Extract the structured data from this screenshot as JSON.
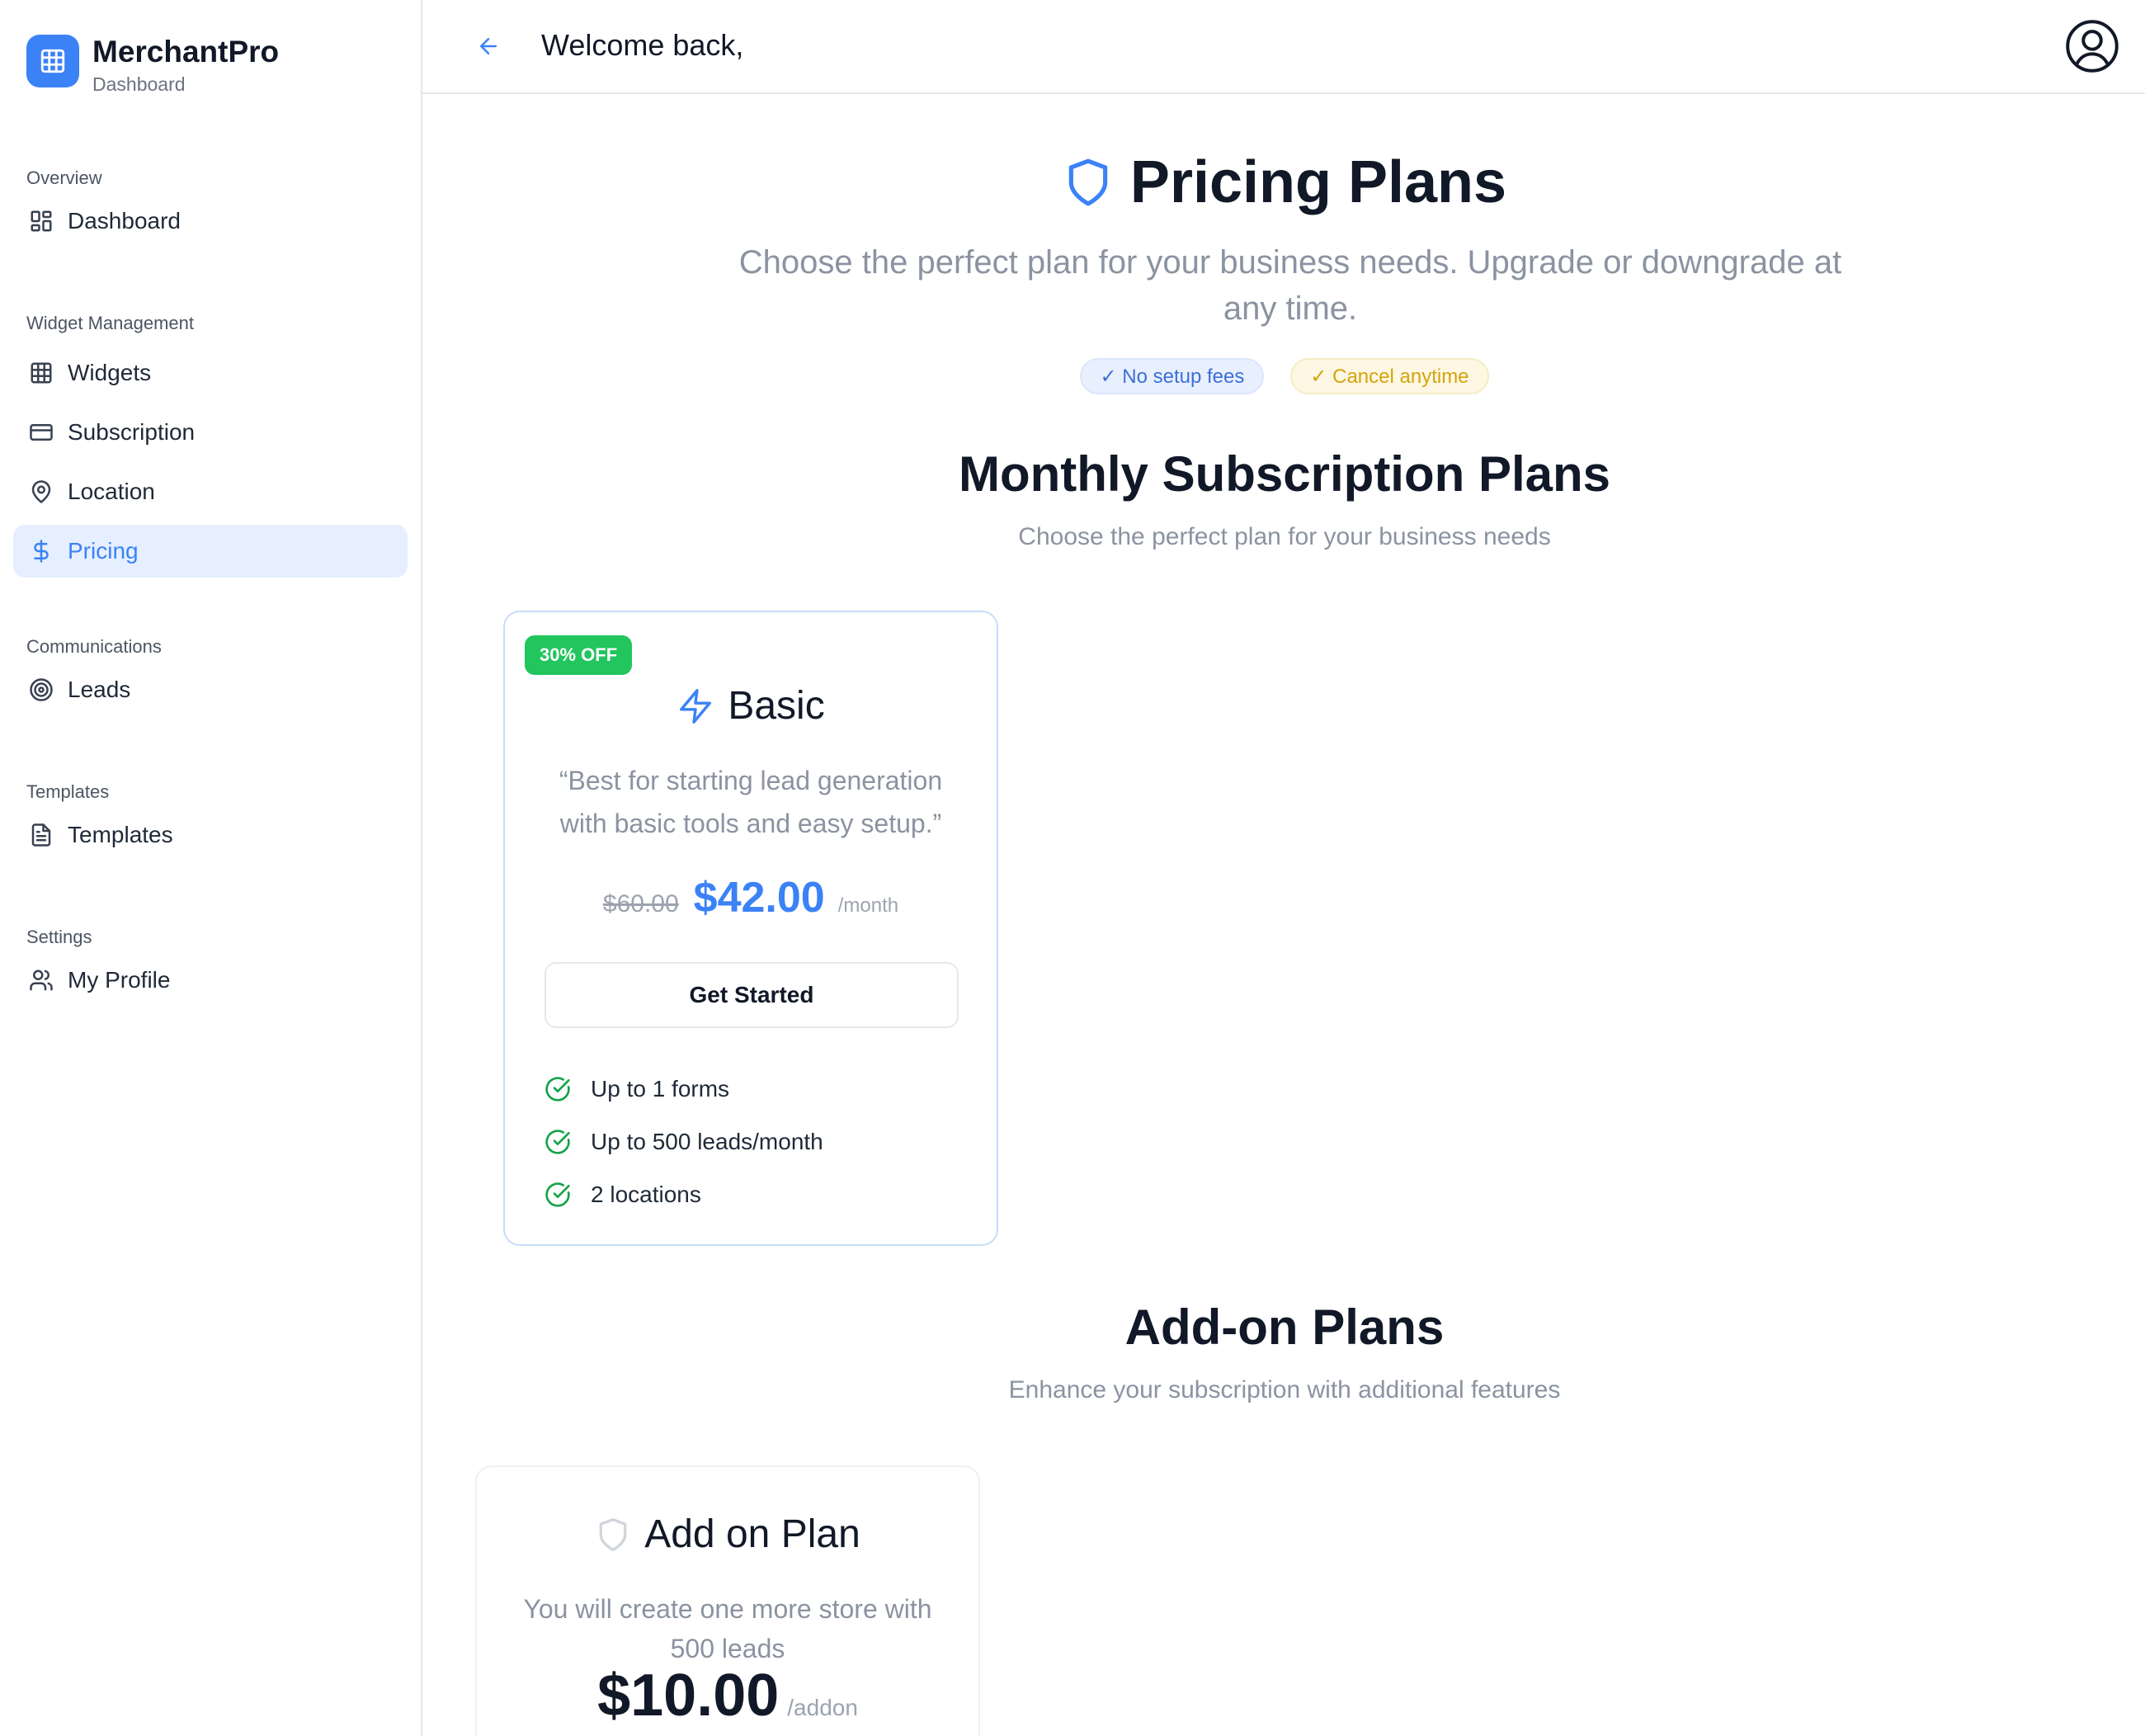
{
  "brand": {
    "name": "MerchantPro",
    "subtitle": "Dashboard",
    "icon": "grid-icon"
  },
  "sidebar": {
    "sections": [
      {
        "heading": "Overview",
        "items": [
          {
            "label": "Dashboard",
            "icon": "layout-dashboard-icon"
          }
        ]
      },
      {
        "heading": "Widget Management",
        "items": [
          {
            "label": "Widgets",
            "icon": "grid-icon"
          },
          {
            "label": "Subscription",
            "icon": "credit-card-icon"
          },
          {
            "label": "Location",
            "icon": "map-pin-icon"
          },
          {
            "label": "Pricing",
            "icon": "dollar-sign-icon",
            "active": true
          }
        ]
      },
      {
        "heading": "Communications",
        "items": [
          {
            "label": "Leads",
            "icon": "target-icon"
          }
        ]
      },
      {
        "heading": "Templates",
        "items": [
          {
            "label": "Templates",
            "icon": "file-text-icon"
          }
        ]
      },
      {
        "heading": "Settings",
        "items": [
          {
            "label": "My Profile",
            "icon": "users-icon"
          }
        ]
      }
    ]
  },
  "header": {
    "welcome": "Welcome back,",
    "back_icon": "arrow-left-icon",
    "avatar_icon": "user-circle-icon"
  },
  "hero": {
    "title": "Pricing Plans",
    "subtitle": "Choose the perfect plan for your business needs. Upgrade or downgrade at any time.",
    "badges": [
      "✓ No setup fees",
      "✓ Cancel anytime"
    ]
  },
  "monthly": {
    "title": "Monthly Subscription Plans",
    "subtitle": "Choose the perfect plan for your business needs",
    "plans": [
      {
        "discount": "30% OFF",
        "name": "Basic",
        "description": "“Best for starting lead generation with basic tools and easy setup.”",
        "old_price": "$60.00",
        "price": "$42.00",
        "period": "/month",
        "cta": "Get Started",
        "features": [
          "Up to 1 forms",
          "Up to 500 leads/month",
          "2 locations"
        ]
      }
    ]
  },
  "addons": {
    "title": "Add-on Plans",
    "subtitle": "Enhance your subscription with additional features",
    "plans": [
      {
        "name": "Add on Plan",
        "description": "You will create one more store with 500 leads",
        "price": "$10.00",
        "period": "/addon"
      }
    ]
  },
  "colors": {
    "accent": "#3b82f6",
    "success": "#22c55e",
    "muted": "#8b93a1",
    "active_bg": "#e5efff"
  }
}
